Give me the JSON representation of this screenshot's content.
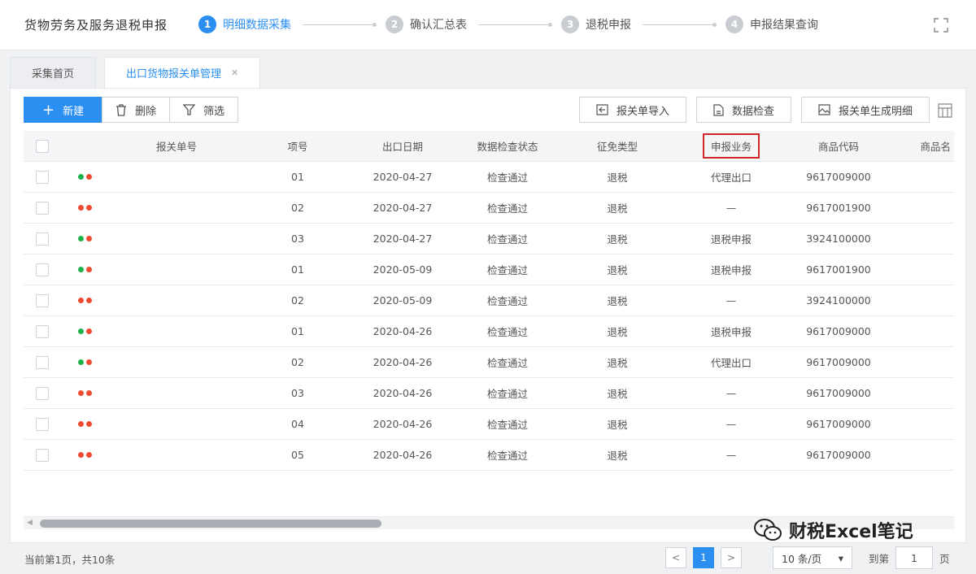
{
  "header": {
    "title": "货物劳务及服务退税申报",
    "steps": [
      {
        "num": "1",
        "label": "明细数据采集"
      },
      {
        "num": "2",
        "label": "确认汇总表"
      },
      {
        "num": "3",
        "label": "退税申报"
      },
      {
        "num": "4",
        "label": "申报结果查询"
      }
    ]
  },
  "tabs": [
    {
      "label": "采集首页"
    },
    {
      "label": "出口货物报关单管理"
    }
  ],
  "toolbar": {
    "new_label": "新建",
    "delete_label": "删除",
    "filter_label": "筛选",
    "import_label": "报关单导入",
    "check_label": "数据检查",
    "generate_label": "报关单生成明细"
  },
  "table": {
    "columns": [
      "报关单号",
      "项号",
      "出口日期",
      "数据检查状态",
      "征免类型",
      "申报业务",
      "商品代码",
      "商品名"
    ],
    "rows": [
      {
        "dots": [
          "#1fb24a",
          "#f04b32"
        ],
        "tail": "8",
        "item": "01",
        "date": "2020-04-27",
        "status": "检查通过",
        "type": "退税",
        "biz": "代理出口",
        "code": "9617009000"
      },
      {
        "dots": [
          "#f04b32",
          "#f04b32"
        ],
        "tail": "9",
        "item": "02",
        "date": "2020-04-27",
        "status": "检查通过",
        "type": "退税",
        "biz": "—",
        "code": "9617001900"
      },
      {
        "dots": [
          "#1fb24a",
          "#f04b32"
        ],
        "tail": "8",
        "item": "03",
        "date": "2020-04-27",
        "status": "检查通过",
        "type": "退税",
        "biz": "退税申报",
        "code": "3924100000"
      },
      {
        "dots": [
          "#1fb24a",
          "#f04b32"
        ],
        "tail": "9",
        "item": "01",
        "date": "2020-05-09",
        "status": "检查通过",
        "type": "退税",
        "biz": "退税申报",
        "code": "9617001900"
      },
      {
        "dots": [
          "#f04b32",
          "#f04b32"
        ],
        "tail": "9",
        "item": "02",
        "date": "2020-05-09",
        "status": "检查通过",
        "type": "退税",
        "biz": "—",
        "code": "3924100000"
      },
      {
        "dots": [
          "#1fb24a",
          "#f04b32"
        ],
        "tail": "9",
        "item": "01",
        "date": "2020-04-26",
        "status": "检查通过",
        "type": "退税",
        "biz": "退税申报",
        "code": "9617009000"
      },
      {
        "dots": [
          "#1fb24a",
          "#f04b32"
        ],
        "tail": "9",
        "item": "02",
        "date": "2020-04-26",
        "status": "检查通过",
        "type": "退税",
        "biz": "代理出口",
        "code": "9617009000"
      },
      {
        "dots": [
          "#f04b32",
          "#f04b32"
        ],
        "tail": "9",
        "item": "03",
        "date": "2020-04-26",
        "status": "检查通过",
        "type": "退税",
        "biz": "—",
        "code": "9617009000"
      },
      {
        "dots": [
          "#f04b32",
          "#f04b32"
        ],
        "tail": "9",
        "item": "04",
        "date": "2020-04-26",
        "status": "检查通过",
        "type": "退税",
        "biz": "—",
        "code": "9617009000"
      },
      {
        "dots": [
          "#f04b32",
          "#f04b32"
        ],
        "tail": "9",
        "item": "05",
        "date": "2020-04-26",
        "status": "检查通过",
        "type": "退税",
        "biz": "—",
        "code": "9617009000"
      }
    ]
  },
  "footer": {
    "info": "当前第1页，共10条",
    "current_page": "1",
    "page_size": "10 条/页",
    "jump_label": "到第",
    "jump_value": "1",
    "jump_suffix": "页"
  },
  "watermark": {
    "text": "财税Excel笔记"
  },
  "colors": {
    "accent": "#2b8ff2",
    "highlight": "#d0252b"
  }
}
